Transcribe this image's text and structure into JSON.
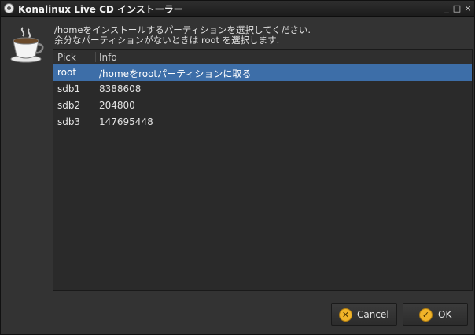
{
  "window": {
    "title": "Konalinux Live CD インストーラー",
    "controls": {
      "minimize": "_",
      "maximize": "□",
      "close": "×"
    }
  },
  "app_icon": "coffee-cup-icon",
  "instructions": {
    "line1": "/homeをインストールするパーティションを選択してください.",
    "line2": "余分なパーティションがないときは root を選択します."
  },
  "table": {
    "columns": {
      "pick": "Pick",
      "info": "Info"
    },
    "rows": [
      {
        "pick": "root",
        "info": "/homeをrootパーティションに取る"
      },
      {
        "pick": "sdb1",
        "info": "8388608"
      },
      {
        "pick": "sdb2",
        "info": "204800"
      },
      {
        "pick": "sdb3",
        "info": "147695448"
      }
    ],
    "selected_row": 0,
    "selection_color": "#3d6ea8"
  },
  "buttons": {
    "cancel": {
      "label": "Cancel",
      "icon": "cancel-icon",
      "glyph": "✕"
    },
    "ok": {
      "label": "OK",
      "icon": "ok-check-icon",
      "glyph": "✓"
    }
  }
}
